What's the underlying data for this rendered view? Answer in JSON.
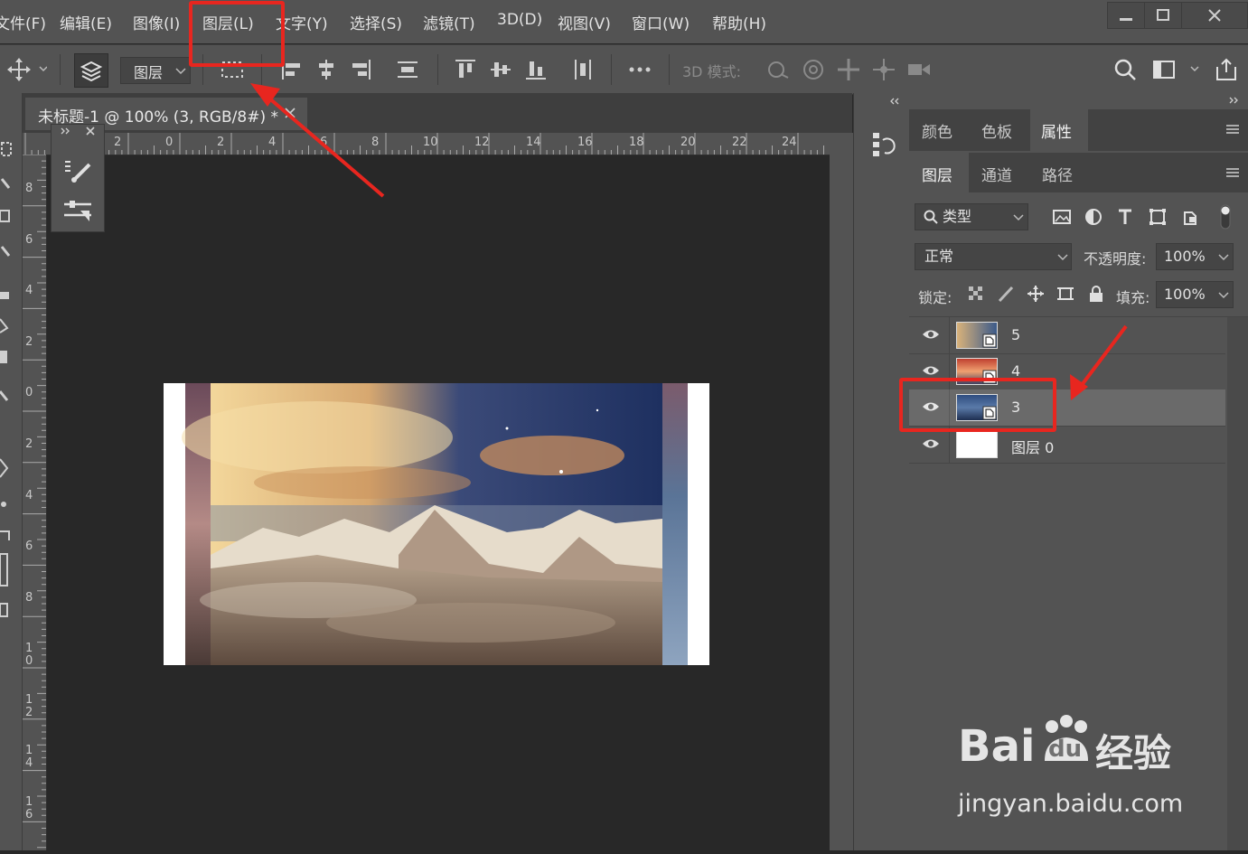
{
  "menubar": {
    "items": [
      "文件(F)",
      "编辑(E)",
      "图像(I)",
      "图层(L)",
      "文字(Y)",
      "选择(S)",
      "滤镜(T)",
      "3D(D)",
      "视图(V)",
      "窗口(W)",
      "帮助(H)"
    ]
  },
  "options": {
    "layer_dropdown": "图层",
    "mode_3d": "3D 模式:"
  },
  "document": {
    "tab_title": "未标题-1 @ 100% (3, RGB/8#) *"
  },
  "rulers": {
    "h_labels": [
      "2",
      "0",
      "2",
      "4",
      "6",
      "8",
      "10",
      "12",
      "14",
      "16",
      "18",
      "20",
      "22",
      "24"
    ],
    "v_labels": [
      "8",
      "6",
      "4",
      "2",
      "0",
      "2",
      "4",
      "6",
      "8",
      "1 0",
      "1 2",
      "1 4",
      "1 6"
    ]
  },
  "panels": {
    "top_tabs": [
      "颜色",
      "色板",
      "属性"
    ],
    "active_top_tab": "属性",
    "layer_tabs": [
      "图层",
      "通道",
      "路径"
    ],
    "active_layer_tab": "图层",
    "filter_kind": "类型",
    "blend_mode": "正常",
    "opacity_label": "不透明度:",
    "opacity_value": "100%",
    "lock_label": "锁定:",
    "fill_label": "填充:",
    "fill_value": "100%"
  },
  "layers": [
    {
      "name": "5",
      "selected": false
    },
    {
      "name": "4",
      "selected": false
    },
    {
      "name": "3",
      "selected": true
    },
    {
      "name": "图层 0",
      "selected": false
    }
  ],
  "watermark": {
    "brand": "Bai",
    "brand2": "du",
    "brand3": "经验",
    "url": "jingyan.baidu.com"
  },
  "colors": {
    "annotation": "#e8261f",
    "panel": "#535353",
    "canvas_bg": "#282828"
  }
}
